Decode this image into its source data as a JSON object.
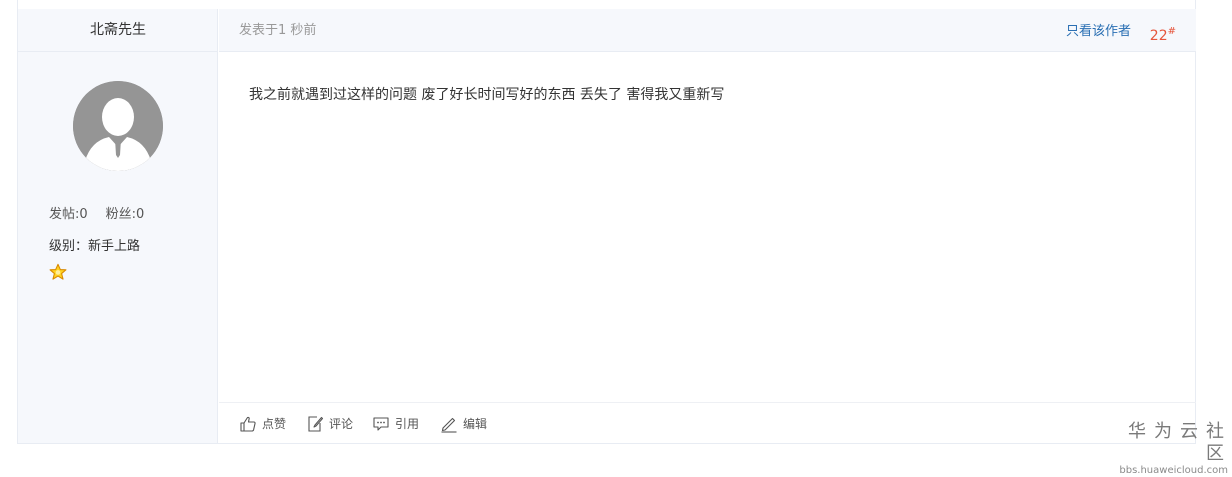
{
  "author": {
    "name": "北斋先生",
    "posts_label": "发帖:0",
    "fans_label": "粉丝:0",
    "level_label": "级别：新手上路"
  },
  "post": {
    "time": "发表于1 秒前",
    "only_author_label": "只看该作者",
    "floor": "22",
    "floor_suffix": "#",
    "content": "我之前就遇到过这样的问题  废了好长时间写好的东西 丢失了  害得我又重新写"
  },
  "actions": {
    "like_label": "点赞",
    "comment_label": "评论",
    "quote_label": "引用",
    "edit_label": "编辑"
  },
  "watermark": {
    "title": "华为云社区",
    "url": "bbs.huaweicloud.com"
  },
  "colors": {
    "sidebar_bg": "#f6f8fc",
    "link": "#2a6fb3",
    "floor": "#e6553c"
  }
}
